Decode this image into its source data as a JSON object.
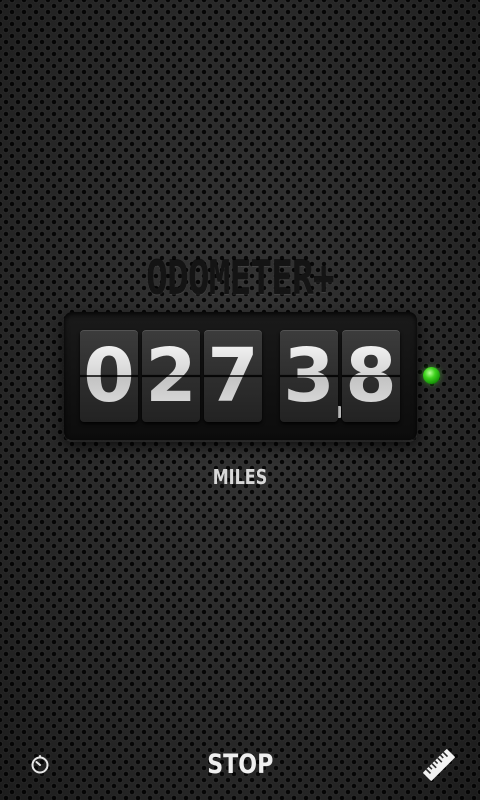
{
  "app": {
    "title": "ODOMETER+"
  },
  "odometer": {
    "digits": [
      "0",
      "2",
      "7",
      "3",
      "8"
    ],
    "unit": "MILES",
    "status_color": "#3fd41e"
  },
  "controls": {
    "timer_icon": "timer-icon",
    "stop_label": "STOP",
    "ruler_icon": "ruler-icon"
  }
}
